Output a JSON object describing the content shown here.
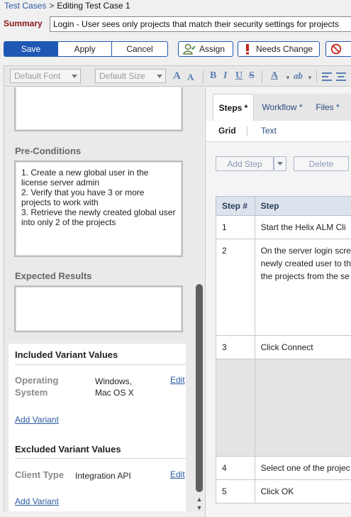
{
  "breadcrumb": {
    "root": "Test Cases",
    "separator": ">",
    "current": "Editing Test Case 1"
  },
  "summary": {
    "label": "Summary",
    "value": "Login - User sees only projects that match their security settings for projects"
  },
  "actions": {
    "save": "Save",
    "apply": "Apply",
    "cancel": "Cancel",
    "assign": "Assign",
    "needs_change": "Needs Change",
    "accent": "#1f57b5"
  },
  "format_toolbar": {
    "font": "Default Font",
    "size": "Default Size",
    "grow_font": "A",
    "shrink_font": "A",
    "bold": "B",
    "italic": "I",
    "underline": "U",
    "strike": "S",
    "font_color": "A",
    "highlight": "ab"
  },
  "left": {
    "preconditions_title": "Pre-Conditions",
    "preconditions_text": "1. Create a new global user in the\nlicense server admin\n2. Verify that you have 3 or more\nprojects to work with\n3. Retrieve the newly created global user\ninto only 2 of the projects",
    "expected_title": "Expected Results",
    "expected_text": "",
    "included": {
      "title": "Included Variant Values",
      "key_line1": "Operating",
      "key_line2": "System",
      "value_line1": "Windows,",
      "value_line2": "Mac OS X",
      "edit": "Edit",
      "add": "Add Variant"
    },
    "excluded": {
      "title": "Excluded Variant Values",
      "key": "Client Type",
      "value": "Integration API",
      "edit": "Edit",
      "add": "Add Variant"
    }
  },
  "right": {
    "tabs": [
      "Steps *",
      "Workflow *",
      "Files *"
    ],
    "subtabs": [
      "Grid",
      "Text"
    ],
    "add_step": "Add Step",
    "delete": "Delete",
    "grid": {
      "headers": [
        "Step #",
        "Step"
      ],
      "rows": [
        {
          "num": "1",
          "lines": [
            "Start the Helix ALM Cli"
          ]
        },
        {
          "num": "2",
          "lines": [
            "On the server login scre",
            "newly created user to th",
            "the projects from the se"
          ]
        },
        {
          "num": "3",
          "lines": [
            "Click Connect"
          ]
        },
        {
          "num": "",
          "lines": []
        },
        {
          "num": "4",
          "lines": [
            "Select one of the projec"
          ]
        },
        {
          "num": "5",
          "lines": [
            "Click OK"
          ]
        }
      ]
    }
  }
}
